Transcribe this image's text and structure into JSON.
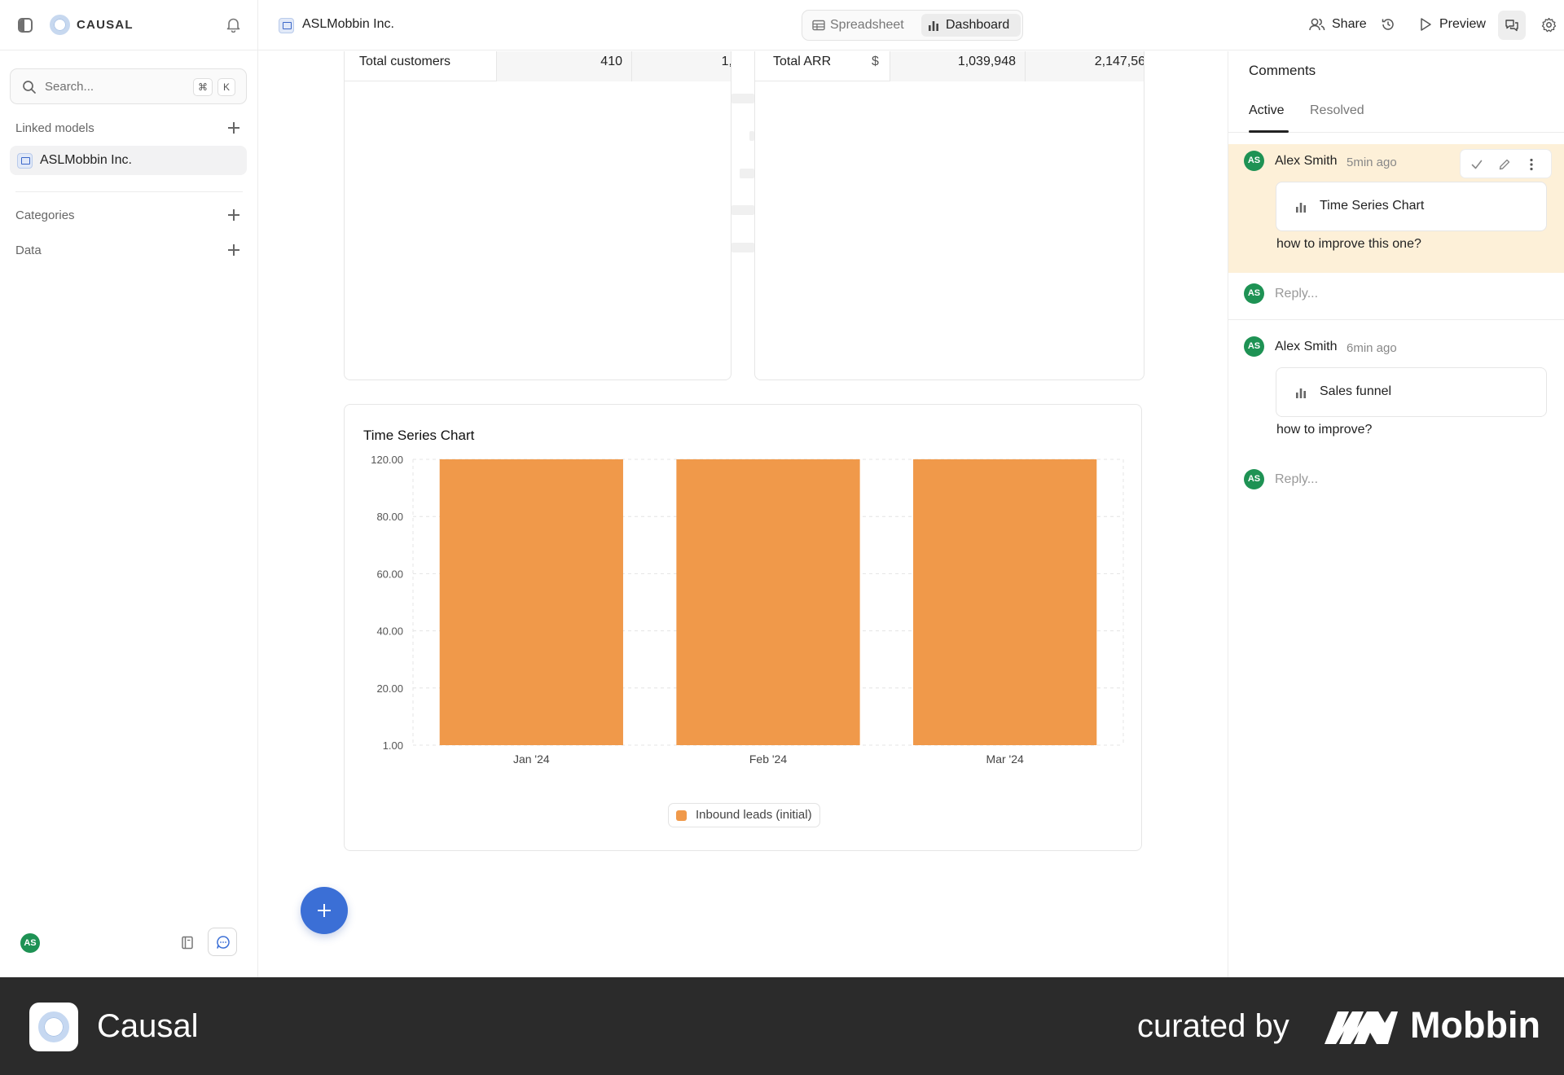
{
  "app": {
    "logo_text": "CAUSAL",
    "document_title": "ASLMobbin Inc."
  },
  "sidebar": {
    "search_placeholder": "Search...",
    "shortcut_keys": [
      "⌘",
      "K"
    ],
    "sections": [
      {
        "label": "Linked models"
      },
      {
        "label": "Categories"
      },
      {
        "label": "Data"
      }
    ],
    "linked_model": "ASLMobbin Inc.",
    "user_initials": "AS"
  },
  "header": {
    "views": [
      {
        "label": "Spreadsheet",
        "icon": "table-icon",
        "active": false
      },
      {
        "label": "Dashboard",
        "icon": "bar-chart-icon",
        "active": true
      }
    ],
    "share_label": "Share",
    "preview_label": "Preview"
  },
  "tables": {
    "customers": {
      "label": "Total customers",
      "values": [
        "410",
        "1,"
      ]
    },
    "arr": {
      "label": "Total ARR",
      "unit": "$",
      "values": [
        "1,039,948",
        "2,147,56"
      ]
    }
  },
  "chart_data": {
    "type": "bar",
    "title": "Time Series Chart",
    "categories": [
      "Jan '24",
      "Feb '24",
      "Mar '24"
    ],
    "series": [
      {
        "name": "Inbound leads (initial)",
        "values": [
          120,
          120,
          120
        ],
        "color": "#f0994a"
      }
    ],
    "y_ticks": [
      "120.00",
      "80.00",
      "60.00",
      "40.00",
      "20.00",
      "1.00"
    ],
    "grid": true,
    "legend": "bottom-center"
  },
  "comments": {
    "title": "Comments",
    "tabs": [
      {
        "label": "Active",
        "active": true
      },
      {
        "label": "Resolved",
        "active": false
      }
    ],
    "threads": [
      {
        "initials": "AS",
        "author": "Alex Smith",
        "time": "5min ago",
        "reference": "Time Series Chart",
        "body": "how to improve this one?",
        "reply_placeholder": "Reply...",
        "highlighted": true
      },
      {
        "initials": "AS",
        "author": "Alex Smith",
        "time": "6min ago",
        "reference": "Sales funnel",
        "body": "how to improve?",
        "reply_placeholder": "Reply...",
        "highlighted": false
      }
    ]
  },
  "banner": {
    "app_name": "Causal",
    "curated_by": "curated by",
    "brand": "Mobbin"
  },
  "colors": {
    "accent": "#3b6fd6",
    "bar": "#f0994a",
    "highlight": "#fdf0d8",
    "avatar": "#1e9254"
  }
}
